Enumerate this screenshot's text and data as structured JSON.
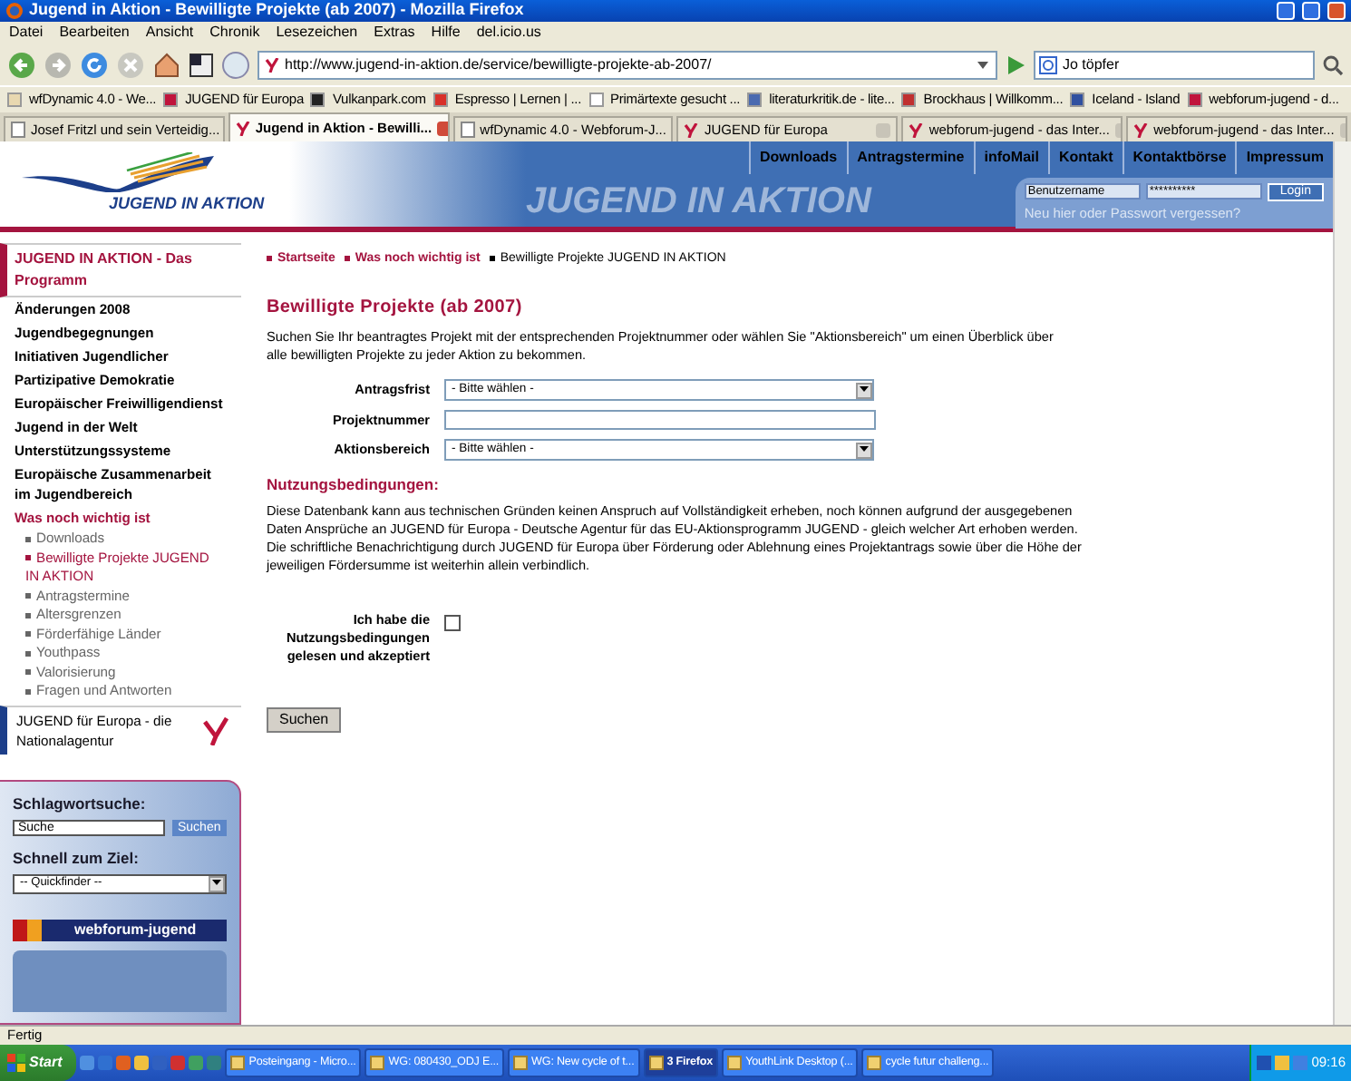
{
  "window": {
    "title": "Jugend in Aktion - Bewilligte Projekte (ab 2007) - Mozilla Firefox"
  },
  "menu": [
    "Datei",
    "Bearbeiten",
    "Ansicht",
    "Chronik",
    "Lesezeichen",
    "Extras",
    "Hilfe",
    "del.icio.us"
  ],
  "address_bar": {
    "url": "http://www.jugend-in-aktion.de/service/bewilligte-projekte-ab-2007/"
  },
  "search_bar": {
    "value": "Jo töpfer"
  },
  "bookmarks": [
    "wfDynamic 4.0 - We...",
    "JUGEND für Europa",
    "Vulkanpark.com",
    "Espresso | Lernen | ...",
    "Primärtexte gesucht ...",
    "literaturkritik.de - lite...",
    "Brockhaus | Willkomm...",
    "Iceland - Island",
    "webforum-jugend - d..."
  ],
  "tabs": [
    {
      "label": "Josef Fritzl und sein Verteidig...",
      "selected": false
    },
    {
      "label": "Jugend in Aktion - Bewilli...",
      "selected": true
    },
    {
      "label": "wfDynamic 4.0 - Webforum-J...",
      "selected": false
    },
    {
      "label": "JUGEND für Europa",
      "selected": false
    },
    {
      "label": "webforum-jugend - das Inter...",
      "selected": false
    },
    {
      "label": "webforum-jugend - das Inter...",
      "selected": false
    }
  ],
  "site": {
    "logo_text": "JUGEND IN AKTION",
    "banner_text": "JUGEND IN AKTION",
    "nav": [
      "Downloads",
      "Antragstermine",
      "infoMail",
      "Kontakt",
      "Kontaktbörse",
      "Impressum"
    ],
    "login": {
      "username": "Benutzername",
      "password": "**********",
      "button": "Login",
      "link": "Neu hier oder Passwort vergessen?"
    }
  },
  "sidebar": {
    "heading": "JUGEND IN AKTION - Das Programm",
    "items": [
      {
        "label": "Änderungen 2008",
        "selected": false
      },
      {
        "label": "Jugendbegegnungen",
        "selected": false
      },
      {
        "label": "Initiativen Jugendlicher",
        "selected": false
      },
      {
        "label": "Partizipative Demokratie",
        "selected": false
      },
      {
        "label": "Europäischer Freiwilligendienst",
        "selected": false
      },
      {
        "label": "Jugend in der Welt",
        "selected": false
      },
      {
        "label": "Unterstützungssysteme",
        "selected": false
      },
      {
        "label": "Europäische Zusammenarbeit im Jugendbereich",
        "selected": false
      },
      {
        "label": "Was noch wichtig ist",
        "selected": true,
        "children": [
          {
            "label": "Downloads",
            "selected": false
          },
          {
            "label": "Bewilligte Projekte JUGEND IN AKTION",
            "selected": true
          },
          {
            "label": "Antragstermine",
            "selected": false
          },
          {
            "label": "Altersgrenzen",
            "selected": false
          },
          {
            "label": "Förderfähige Länder",
            "selected": false
          },
          {
            "label": "Youthpass",
            "selected": false
          },
          {
            "label": "Valorisierung",
            "selected": false
          },
          {
            "label": "Fragen und Antworten",
            "selected": false
          }
        ]
      }
    ],
    "agency": "JUGEND für Europa - die Nationalagentur"
  },
  "search_panel": {
    "title": "Schlagwortsuche:",
    "value": "Suche",
    "button": "Suchen",
    "quick_title": "Schnell zum Ziel:",
    "quick_value": "-- Quickfinder --",
    "banner": "webforum-jugend"
  },
  "main": {
    "breadcrumb": [
      {
        "label": "Startseite",
        "kind": "link"
      },
      {
        "label": "Was noch wichtig ist",
        "kind": "link"
      },
      {
        "label": "Bewilligte Projekte JUGEND IN AKTION",
        "kind": "current"
      }
    ],
    "title": "Bewilligte Projekte (ab 2007)",
    "intro": "Suchen Sie Ihr beantragtes Projekt mit der entsprechenden Projektnummer oder wählen Sie \"Aktionsbereich\" um einen Überblick über alle bewilligten Projekte zu jeder Aktion zu bekommen.",
    "fields": [
      {
        "label": "Antragsfrist",
        "kind": "select",
        "value": "- Bitte wählen -"
      },
      {
        "label": "Projektnummer",
        "kind": "text"
      },
      {
        "label": "Aktionsbereich",
        "kind": "select",
        "value": "- Bitte wählen -"
      }
    ],
    "terms_title": "Nutzungsbedingungen:",
    "terms_text": "Diese Datenbank kann aus technischen Gründen keinen Anspruch auf Vollständigkeit erheben, noch können aufgrund der ausgegebenen Daten Ansprüche an JUGEND für Europa - Deutsche Agentur für das EU-Aktionsprogramm JUGEND - gleich welcher Art erhoben werden. Die schriftliche Benachrichtigung durch JUGEND für Europa über Förderung oder Ablehnung eines Projektantrags sowie über die Höhe der jeweiligen Fördersumme ist weiterhin allein verbindlich.",
    "accept": {
      "label": "Ich habe die Nutzungsbedingungen gelesen und akzeptiert",
      "checked": false
    },
    "submit": "Suchen"
  },
  "status_bar": "Fertig",
  "taskbar": {
    "start": "Start",
    "items": [
      {
        "label": "Posteingang - Micro...",
        "selected": false
      },
      {
        "label": "WG: 080430_ODJ E...",
        "selected": false
      },
      {
        "label": "WG: New cycle of t...",
        "selected": false
      },
      {
        "label": "3 Firefox",
        "selected": true
      },
      {
        "label": "YouthLink Desktop (...",
        "selected": false
      },
      {
        "label": "cycle futur challeng...",
        "selected": false
      }
    ],
    "clock": "09:16"
  }
}
